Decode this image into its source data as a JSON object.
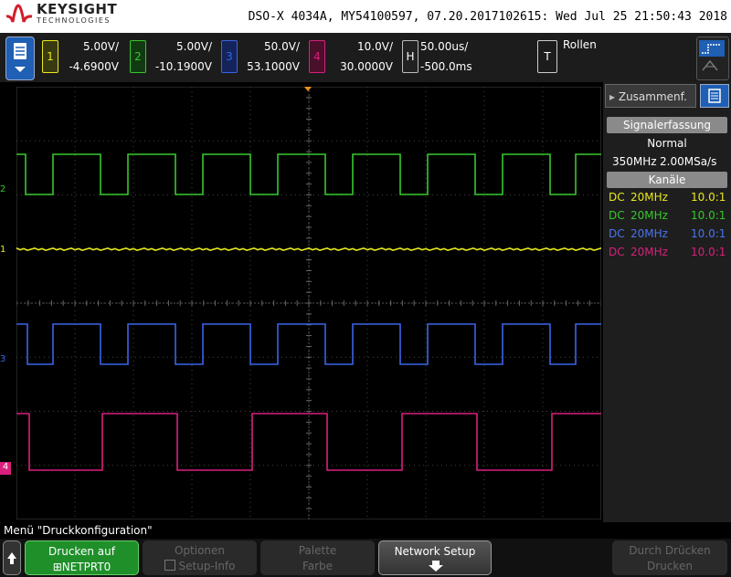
{
  "header": {
    "brand": "KEYSIGHT",
    "brand_sub": "TECHNOLOGIES",
    "title": "DSO-X 4034A, MY54100597, 07.20.2017102615: Wed Jul 25 21:50:43 2018"
  },
  "channels": [
    {
      "num": "1",
      "scale": "5.00V/",
      "offset": "-4.6900V",
      "color": "#e8e81c"
    },
    {
      "num": "2",
      "scale": "5.00V/",
      "offset": "-10.1900V",
      "color": "#35c92a"
    },
    {
      "num": "3",
      "scale": "50.0V/",
      "offset": "53.1000V",
      "color": "#3a64e8"
    },
    {
      "num": "4",
      "scale": "10.0V/",
      "offset": "30.0000V",
      "color": "#d8207c"
    }
  ],
  "timebase": {
    "label": "H",
    "scale": "50.00us/",
    "delay": "-500.0ms"
  },
  "trigger": {
    "label": "T",
    "mode": "Rollen"
  },
  "markers": {
    "ch1": "1",
    "ch2": "2",
    "ch3": "3",
    "ch4": "4"
  },
  "panel": {
    "tab": "Zusammenf.",
    "acq_header": "Signalerfassung",
    "acq_mode": "Normal",
    "bandwidth": "350MHz",
    "sample_rate": "2.00MSa/s",
    "channels_header": "Kanäle",
    "rows": [
      {
        "coupling": "DC",
        "bw": "20MHz",
        "probe": "10.0:1"
      },
      {
        "coupling": "DC",
        "bw": "20MHz",
        "probe": "10.0:1"
      },
      {
        "coupling": "DC",
        "bw": "20MHz",
        "probe": "10.0:1"
      },
      {
        "coupling": "DC",
        "bw": "20MHz",
        "probe": "10.0:1"
      }
    ]
  },
  "footer": {
    "menu_caption": "Menü \"Druckkonfiguration\"",
    "softkeys": [
      {
        "line1": "Drucken auf",
        "line2": "NETPRT0"
      },
      {
        "line1": "Optionen",
        "line2": "Setup-Info"
      },
      {
        "line1": "Palette",
        "line2": "Farbe"
      },
      {
        "line1": "Network Setup",
        "line2": ""
      },
      {
        "line1": "Durch Drücken",
        "line2": "Drucken"
      }
    ]
  }
}
